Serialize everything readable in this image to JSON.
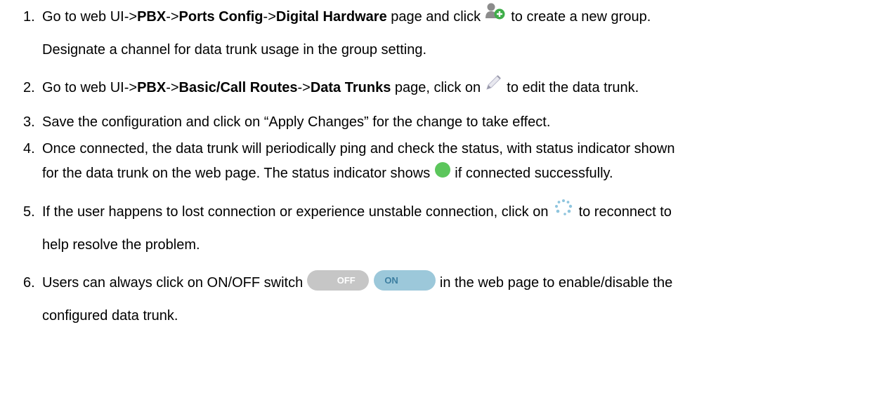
{
  "steps": [
    {
      "num": "1.",
      "p1": "Go to web UI->",
      "b1": "PBX",
      "p2": "->",
      "b2": "Ports Config",
      "p3": "->",
      "b3": "Digital Hardware",
      "p4": " page and click ",
      "p5": " to create a new group.",
      "line2": "Designate a channel for data trunk usage in the group setting."
    },
    {
      "num": "2.",
      "p1": "Go to web UI->",
      "b1": "PBX",
      "p2": "->",
      "b2": "Basic/Call Routes",
      "p3": "->",
      "b3": "Data Trunks",
      "p4": " page, click on ",
      "p5": " to edit the data trunk."
    },
    {
      "num": "3.",
      "text": "Save the configuration and click on “Apply Changes” for the change to take effect."
    },
    {
      "num": "4.",
      "line1": "Once connected, the data trunk will periodically ping and check the status, with status indicator shown",
      "line2a": "for the data trunk on the web page. The status indicator shows ",
      "line2b": " if connected successfully."
    },
    {
      "num": "5.",
      "line1a": "If the user happens to lost connection or experience unstable connection, click on ",
      "line1b": " to reconnect to",
      "line2": "help resolve the problem."
    },
    {
      "num": "6.",
      "line1a": "Users can always click on ON/OFF switch ",
      "off_label": "OFF",
      "on_label": "ON",
      "line1b": " in the web page to enable/disable the",
      "line2": "configured data trunk."
    }
  ],
  "colors": {
    "add_icon_green": "#3fae49",
    "status_green": "#5cc65c",
    "toggle_on_bg": "#9cc8da",
    "toggle_off_bg": "#c6c6c6"
  },
  "icons": [
    "add-group-icon",
    "edit-pencil-icon",
    "status-connected-icon",
    "reconnect-icon"
  ]
}
